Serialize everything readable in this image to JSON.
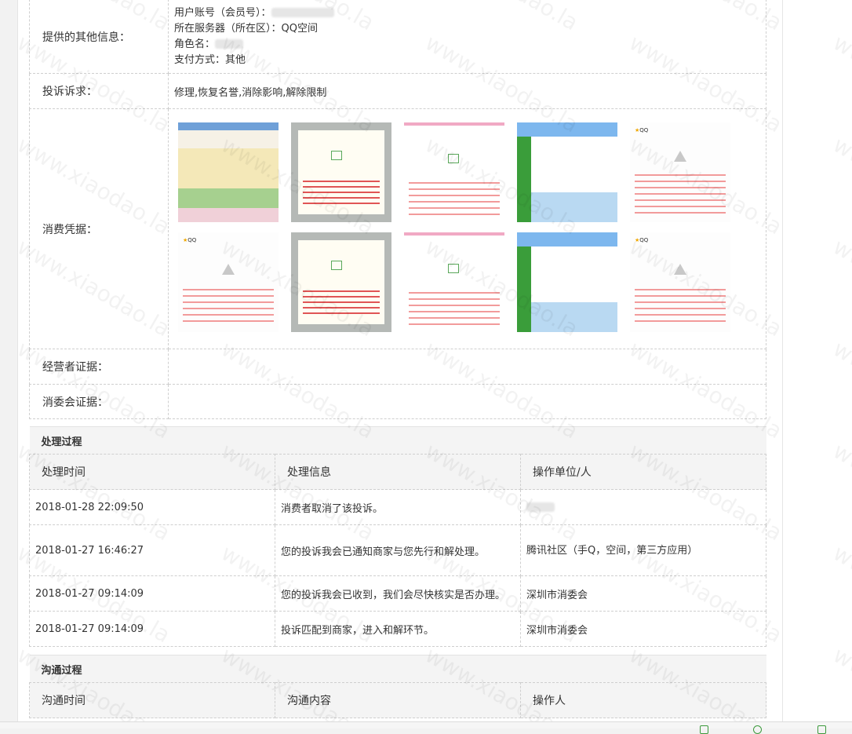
{
  "info": {
    "other_info_label": "提供的其他信息：",
    "other_info_lines": {
      "account": "用户账号（会员号）：",
      "server": "所在服务器（所在区）：QQ空间",
      "role": "角色名：",
      "payment": "支付方式：其他"
    },
    "demand_label": "投诉诉求：",
    "demand_value": "修理,恢复名誉,消除影响,解除限制",
    "evidence_label": "消费凭据：",
    "evidence_images": [
      "thumbnail",
      "thumbnail",
      "thumbnail",
      "thumbnail",
      "thumbnail",
      "thumbnail",
      "thumbnail",
      "thumbnail",
      "thumbnail",
      "thumbnail"
    ],
    "operator_evidence_label": "经营者证据：",
    "council_evidence_label": "消委会证据："
  },
  "process": {
    "title": "处理过程",
    "headers": {
      "time": "处理时间",
      "info": "处理信息",
      "unit": "操作单位/人"
    },
    "rows": [
      {
        "time": "2018-01-28 22:09:50",
        "info": "消费者取消了该投诉。",
        "unit": ""
      },
      {
        "time": "2018-01-27 16:46:27",
        "info": "您的投诉我会已通知商家与您先行和解处理。",
        "unit": "腾讯社区（手Q，空间，第三方应用）"
      },
      {
        "time": "2018-01-27 09:14:09",
        "info": "您的投诉我会已收到，我们会尽快核实是否办理。",
        "unit": "深圳市消委会"
      },
      {
        "time": "2018-01-27 09:14:09",
        "info": "投诉匹配到商家，进入和解环节。",
        "unit": "深圳市消委会"
      }
    ]
  },
  "comm": {
    "title": "沟通过程",
    "headers": {
      "time": "沟通时间",
      "content": "沟通内容",
      "operator": "操作人"
    }
  },
  "watermark": "www.xiaodao.la",
  "colors": {
    "border": "#cfcfcf",
    "header_bg": "#f4f4f4",
    "accent_green": "#3c9a3c"
  }
}
